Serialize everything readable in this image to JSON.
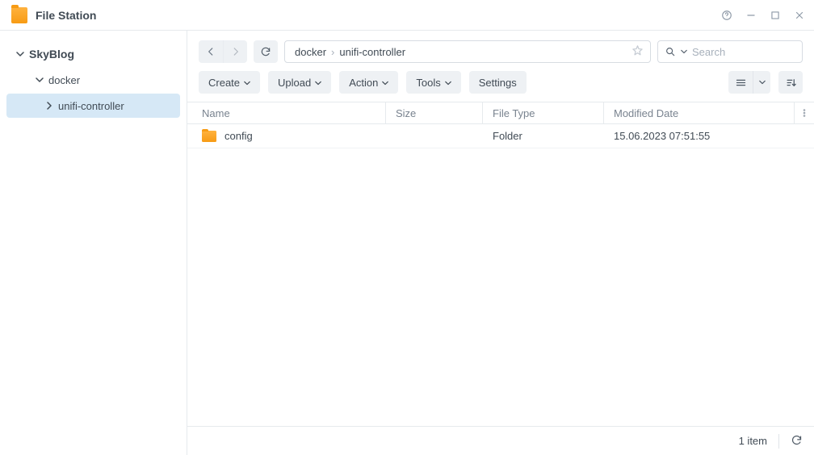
{
  "app": {
    "title": "File Station"
  },
  "sidebar": {
    "root": "SkyBlog",
    "items": [
      {
        "label": "docker"
      },
      {
        "label": "unifi-controller"
      }
    ]
  },
  "breadcrumb": {
    "segments": [
      "docker",
      "unifi-controller"
    ]
  },
  "search": {
    "placeholder": "Search"
  },
  "toolbar": {
    "create": "Create",
    "upload": "Upload",
    "action": "Action",
    "tools": "Tools",
    "settings": "Settings"
  },
  "columns": {
    "name": "Name",
    "size": "Size",
    "type": "File Type",
    "date": "Modified Date"
  },
  "rows": [
    {
      "name": "config",
      "size": "",
      "type": "Folder",
      "date": "15.06.2023 07:51:55"
    }
  ],
  "status": {
    "count": "1 item"
  }
}
